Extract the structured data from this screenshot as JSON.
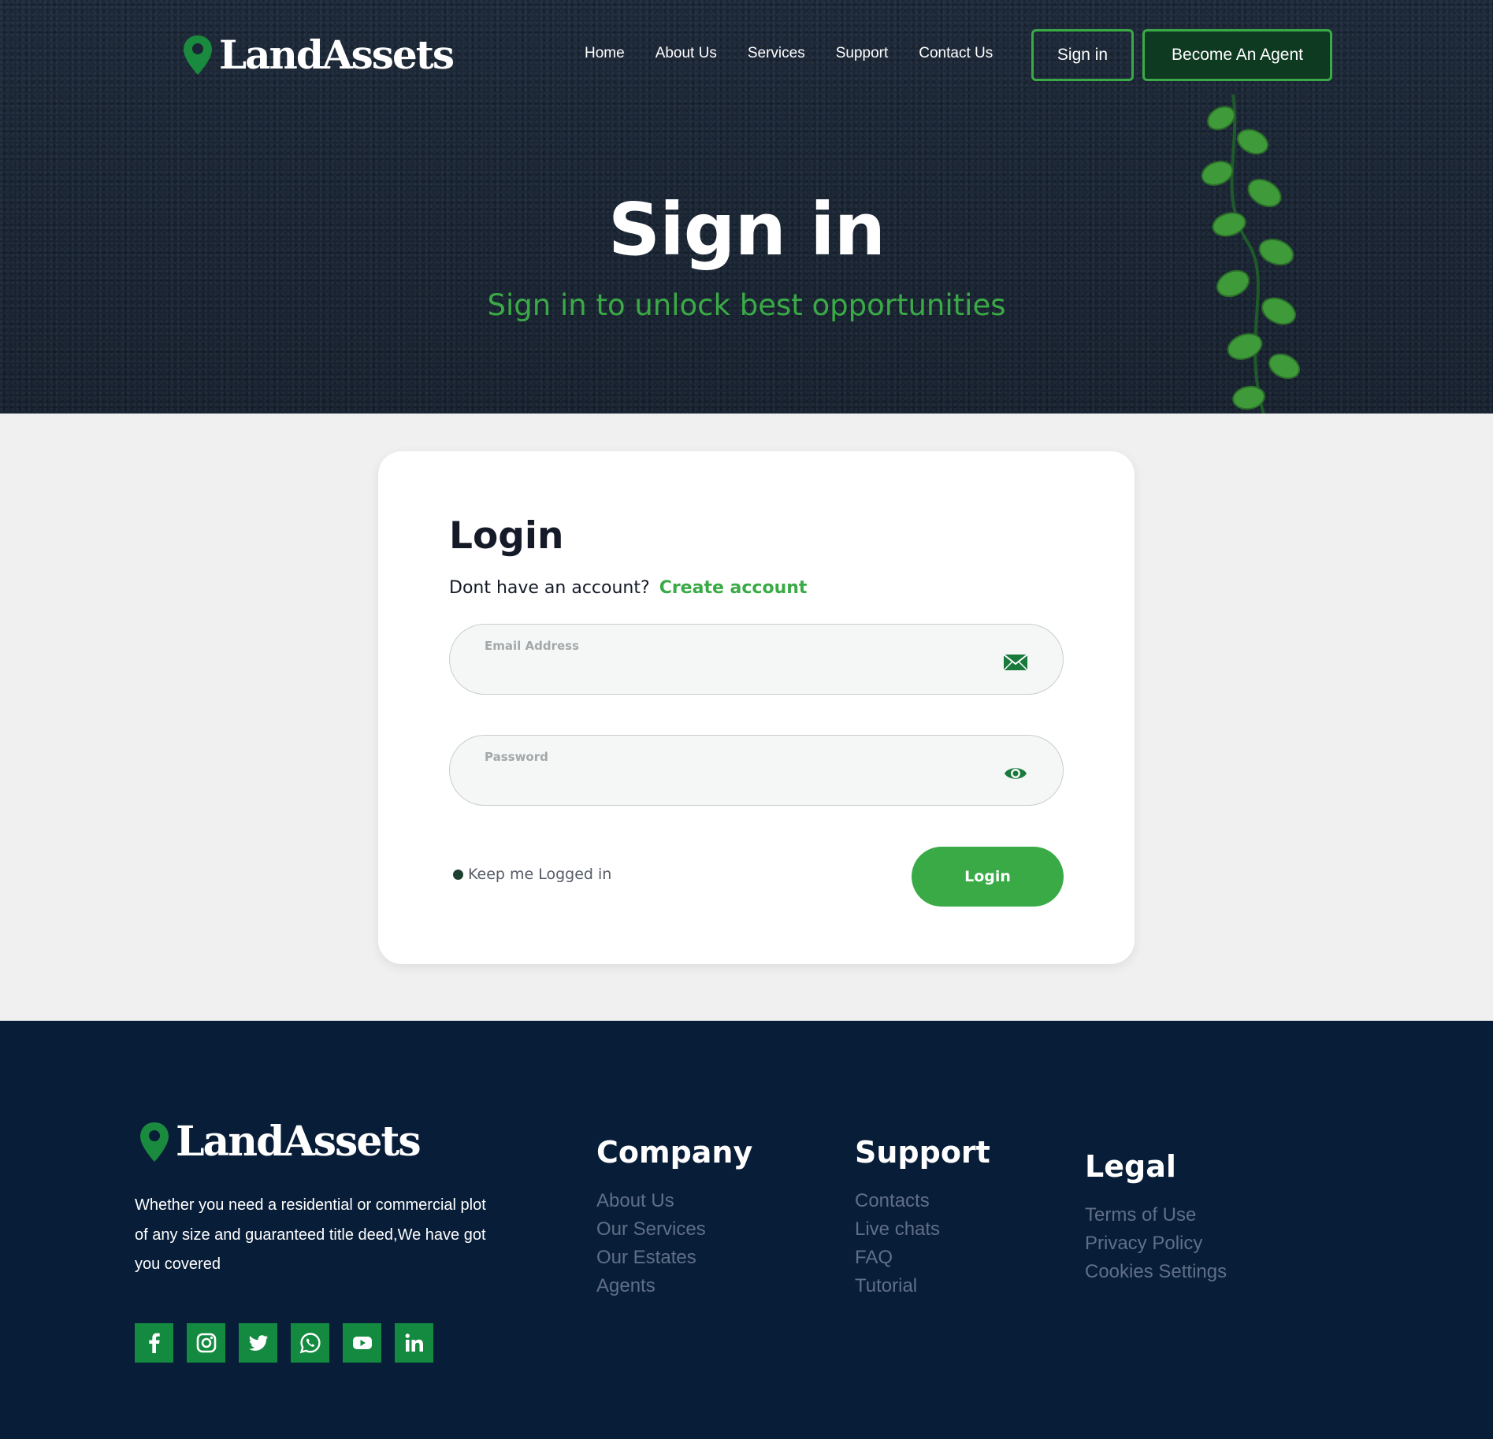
{
  "brand": {
    "name": "LandAssets",
    "accent": "#3aaa46",
    "dark": "#081d38"
  },
  "nav": {
    "items": [
      "Home",
      "About Us",
      "Services",
      "Support",
      "Contact Us"
    ],
    "signin_label": "Sign in",
    "agent_label": "Become An Agent"
  },
  "hero": {
    "title": "Sign in",
    "subtitle": "Sign in to unlock best opportunities"
  },
  "login": {
    "title": "Login",
    "prompt": "Dont have an account?",
    "create_link": "Create account",
    "email_label": "Email Address",
    "email_value": "",
    "password_label": "Password",
    "password_value": "",
    "keep_logged": "Keep me Logged in",
    "submit_label": "Login"
  },
  "footer": {
    "description": "Whether you need a residential or commercial plot of any size and guaranteed title deed,We have got you covered",
    "socials": [
      "facebook-icon",
      "instagram-icon",
      "twitter-icon",
      "whatsapp-icon",
      "youtube-icon",
      "linkedin-icon"
    ],
    "columns": {
      "company": {
        "title": "Company",
        "links": [
          "About Us",
          "Our Services",
          "Our Estates",
          "Agents"
        ]
      },
      "support": {
        "title": "Support",
        "links": [
          "Contacts",
          "Live chats",
          "FAQ",
          "Tutorial"
        ]
      },
      "legal": {
        "title": "Legal",
        "links": [
          "Terms of Use",
          "Privacy Policy",
          "Cookies Settings"
        ]
      }
    }
  }
}
